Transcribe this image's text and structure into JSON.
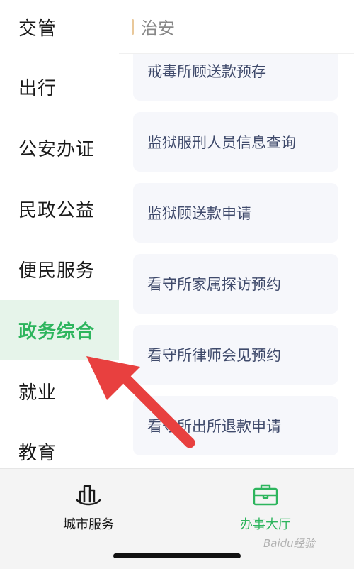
{
  "sidebar": {
    "categories": [
      {
        "label": "交管",
        "active": false
      },
      {
        "label": "出行",
        "active": false
      },
      {
        "label": "公安办证",
        "active": false
      },
      {
        "label": "民政公益",
        "active": false
      },
      {
        "label": "便民服务",
        "active": false
      },
      {
        "label": "政务综合",
        "active": true
      },
      {
        "label": "就业",
        "active": false
      },
      {
        "label": "教育",
        "active": false
      }
    ]
  },
  "content": {
    "section_title": "治安",
    "services": [
      "戒毒所顾送款预存",
      "监狱服刑人员信息查询",
      "监狱顾送款申请",
      "看守所家属探访预约",
      "看守所律师会见预约",
      "看守所出所退款申请"
    ]
  },
  "tabbar": {
    "tabs": [
      {
        "label": "城市服务",
        "icon": "city-buildings-icon",
        "active": false
      },
      {
        "label": "办事大厅",
        "icon": "briefcase-icon",
        "active": true
      }
    ]
  },
  "watermark": "Baidu经验",
  "colors": {
    "accent": "#2db55d",
    "active_bg": "#e6f4ea",
    "card_bg": "#f6f7fb",
    "arrow": "#e8403f"
  }
}
